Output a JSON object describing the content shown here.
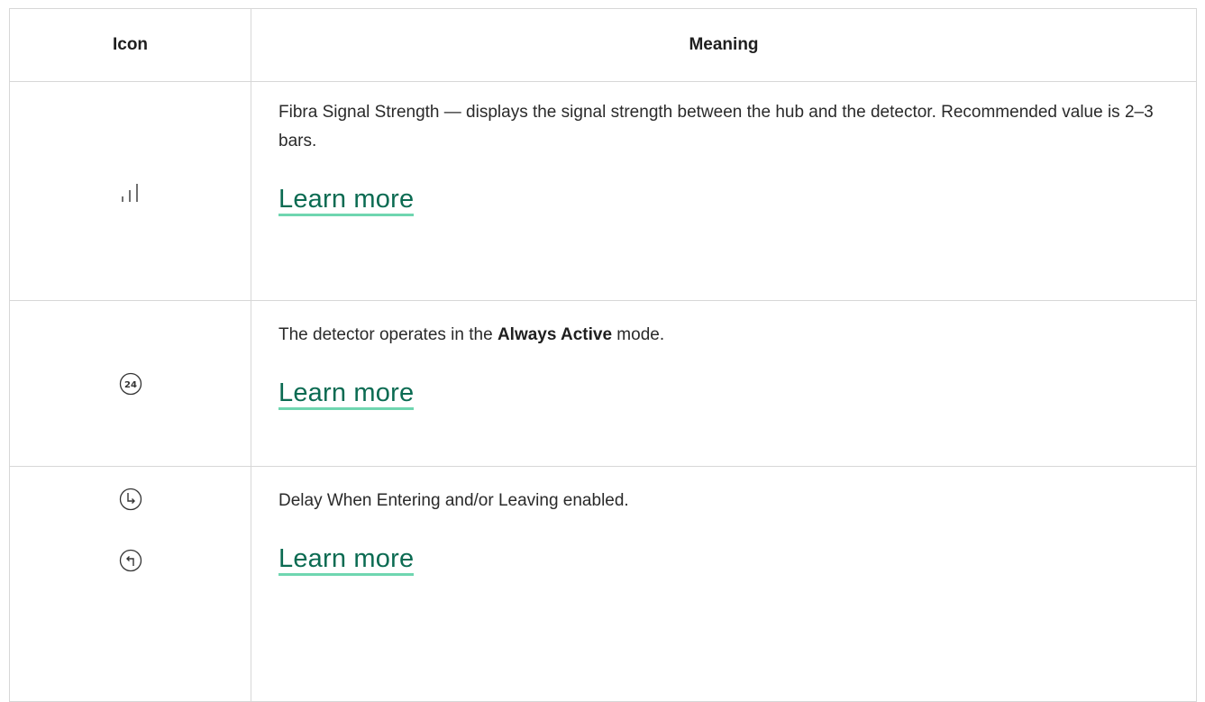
{
  "header": {
    "icon_col": "Icon",
    "meaning_col": "Meaning"
  },
  "rows": [
    {
      "icon": "signal-bars-icon",
      "text": "Fibra Signal Strength — displays the signal strength between the hub and the detector. Recommended value is 2–3 bars.",
      "link": "Learn more"
    },
    {
      "icon": "always-active-24-icon",
      "icon_text": "24",
      "text_before": "The detector operates in the ",
      "text_bold": "Always Active",
      "text_after": " mode.",
      "link": "Learn more"
    },
    {
      "icons": [
        "delay-entering-icon",
        "delay-leaving-icon"
      ],
      "text": "Delay When Entering and/or Leaving enabled.",
      "link": "Learn more"
    }
  ],
  "colors": {
    "link": "#0b6b52",
    "underline": "#6fd6b0",
    "border": "#d7d7d7"
  }
}
